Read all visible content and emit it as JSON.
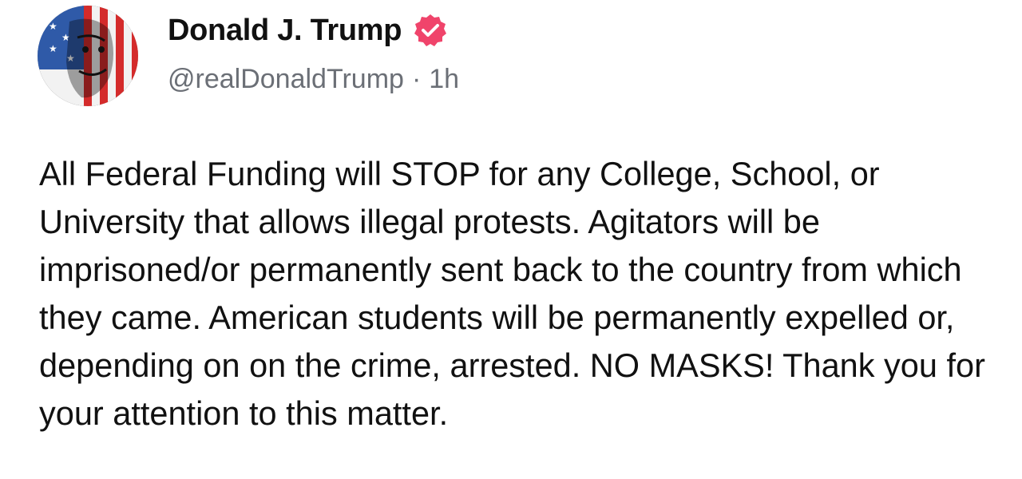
{
  "post": {
    "author": {
      "display_name": "Donald J. Trump",
      "handle": "@realDonaldTrump",
      "separator": "·",
      "timestamp": "1h",
      "avatar_icon": "flag-portrait-avatar",
      "verified_icon": "verified-badge-icon"
    },
    "body": "All Federal Funding will STOP for any College, School, or University that allows illegal protests. Agitators will be imprisoned/or permanently sent back to the country from which they came. American students will be permanently expelled or, depending on on the crime, arrested. NO MASKS! Thank you for your attention to this matter."
  },
  "colors": {
    "verified": "#f0446b",
    "text": "#111111",
    "muted": "#6b6f76",
    "flag_red": "#d42b2b",
    "flag_blue": "#2f5aa8"
  }
}
